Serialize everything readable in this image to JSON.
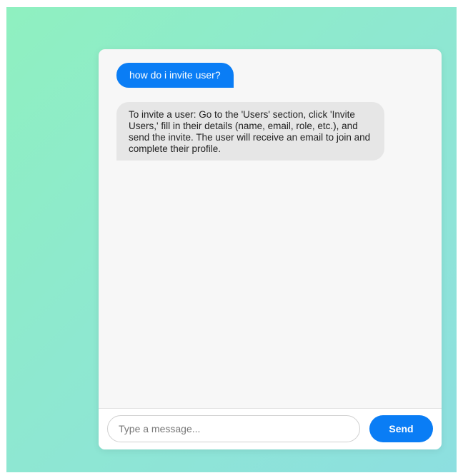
{
  "chat": {
    "messages": [
      {
        "role": "user",
        "text": "how do i invite user?"
      },
      {
        "role": "assistant",
        "text": "To invite a user: Go to the 'Users' section, click 'Invite Users,' fill in their details (name, email, role, etc.), and send the invite. The user will receive an email to join and complete their profile."
      }
    ]
  },
  "composer": {
    "placeholder": "Type a message...",
    "value": "",
    "send_label": "Send"
  },
  "colors": {
    "accent": "#0a7df5",
    "assistant_bubble": "#e6e6e6",
    "background_gradient_start": "#8ff0c0",
    "background_gradient_end": "#8ddfe0"
  }
}
